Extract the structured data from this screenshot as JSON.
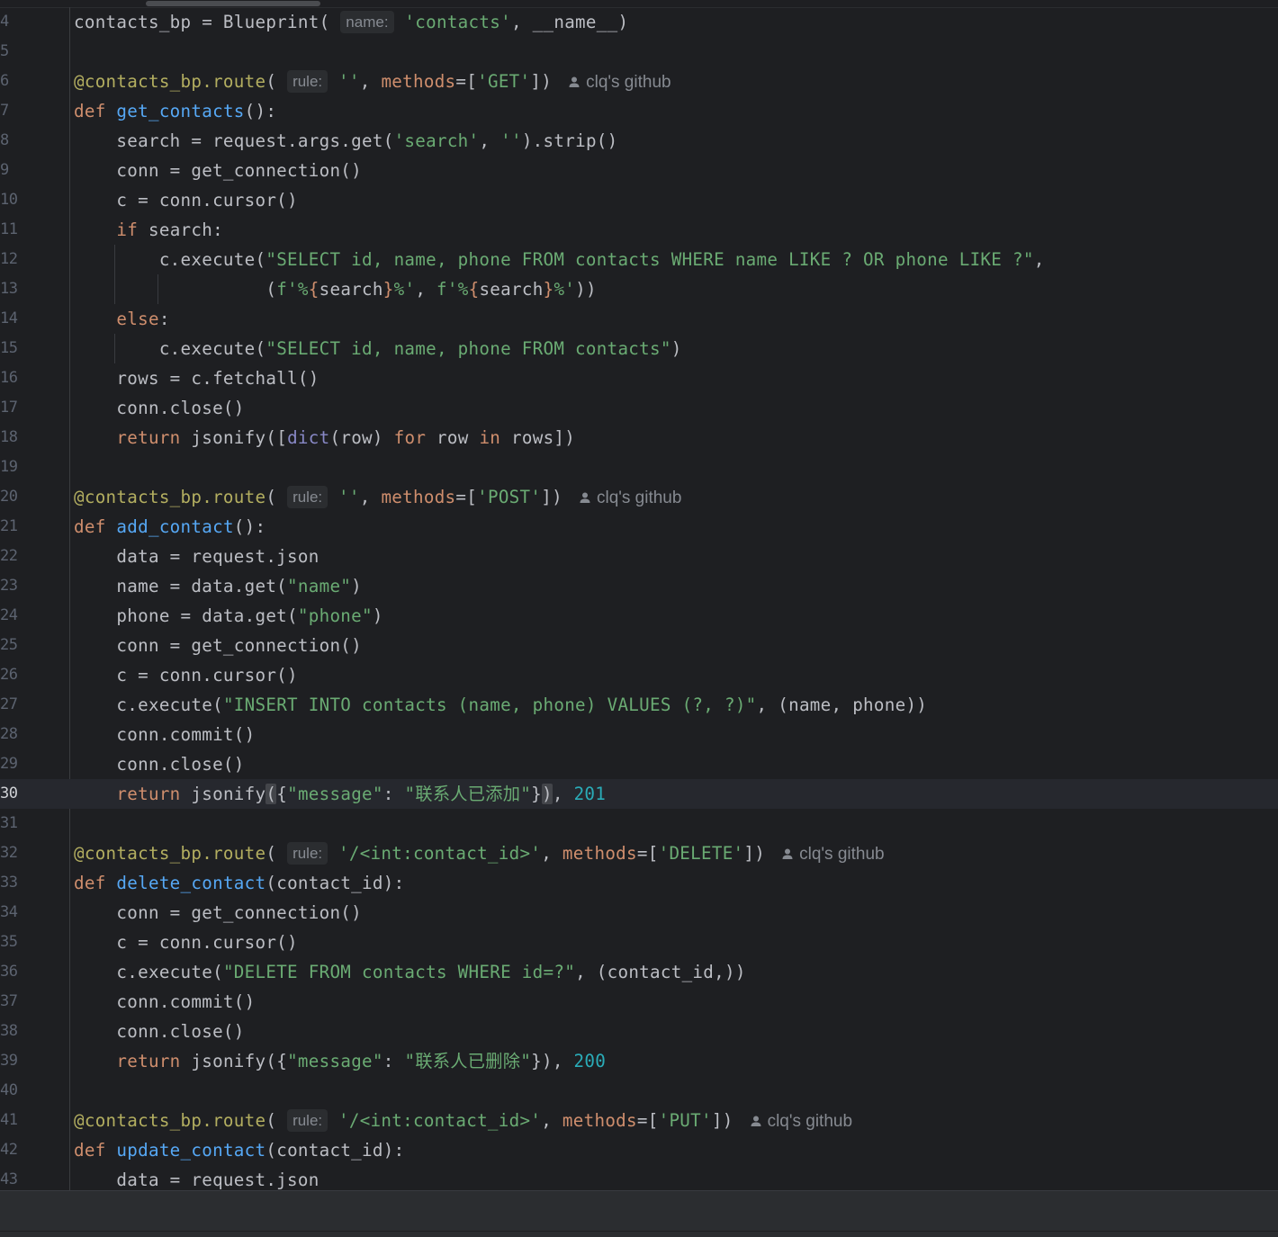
{
  "editor": {
    "language": "python",
    "current_line": "30",
    "blame_author": "clq's github",
    "hints": {
      "name": "name:",
      "rule": "rule:"
    },
    "line_numbers": [
      "4",
      "5",
      "6",
      "7",
      "8",
      "9",
      "10",
      "11",
      "12",
      "13",
      "14",
      "15",
      "16",
      "17",
      "18",
      "19",
      "20",
      "21",
      "22",
      "23",
      "24",
      "25",
      "26",
      "27",
      "28",
      "29",
      "30",
      "31",
      "32",
      "33",
      "34",
      "35",
      "36",
      "37",
      "38",
      "39",
      "40",
      "41",
      "42",
      "43"
    ],
    "lines": [
      "contacts_bp = Blueprint('contacts', __name__)",
      "",
      "@contacts_bp.route('', methods=['GET'])",
      "def get_contacts():",
      "    search = request.args.get('search', '').strip()",
      "    conn = get_connection()",
      "    c = conn.cursor()",
      "    if search:",
      "        c.execute(\"SELECT id, name, phone FROM contacts WHERE name LIKE ? OR phone LIKE ?\",",
      "                  (f'%{search}%', f'%{search}%'))",
      "    else:",
      "        c.execute(\"SELECT id, name, phone FROM contacts\")",
      "    rows = c.fetchall()",
      "    conn.close()",
      "    return jsonify([dict(row) for row in rows])",
      "",
      "@contacts_bp.route('', methods=['POST'])",
      "def add_contact():",
      "    data = request.json",
      "    name = data.get(\"name\")",
      "    phone = data.get(\"phone\")",
      "    conn = get_connection()",
      "    c = conn.cursor()",
      "    c.execute(\"INSERT INTO contacts (name, phone) VALUES (?, ?)\", (name, phone))",
      "    conn.commit()",
      "    conn.close()",
      "    return jsonify({\"message\": \"联系人已添加\"}), 201",
      "",
      "@contacts_bp.route('/<int:contact_id>', methods=['DELETE'])",
      "def delete_contact(contact_id):",
      "    conn = get_connection()",
      "    c = conn.cursor()",
      "    c.execute(\"DELETE FROM contacts WHERE id=?\", (contact_id,))",
      "    conn.commit()",
      "    conn.close()",
      "    return jsonify({\"message\": \"联系人已删除\"}), 200",
      "",
      "@contacts_bp.route('/<int:contact_id>', methods=['PUT'])",
      "def update_contact(contact_id):",
      "    data = request.json"
    ]
  }
}
